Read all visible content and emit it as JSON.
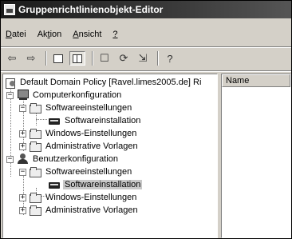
{
  "window": {
    "title": "Gruppenrichtlinienobjekt-Editor"
  },
  "menu": {
    "items": [
      {
        "label": "Datei",
        "mnemonic_index": 0
      },
      {
        "label": "Aktion",
        "mnemonic_index": 2
      },
      {
        "label": "Ansicht",
        "mnemonic_index": 0
      },
      {
        "label": "?",
        "mnemonic_index": 0
      }
    ]
  },
  "toolbar": {
    "buttons": [
      {
        "name": "back-button",
        "glyph": "⇦"
      },
      {
        "name": "forward-button",
        "glyph": "⇨"
      },
      {
        "name": "up-folder-button",
        "glyph": "⌂"
      },
      {
        "name": "show-hide-tree-button",
        "glyph": ""
      },
      {
        "name": "properties-button",
        "glyph": "☐"
      },
      {
        "name": "refresh-button",
        "glyph": "⟳"
      },
      {
        "name": "export-list-button",
        "glyph": "⇲"
      },
      {
        "name": "help-button",
        "glyph": "?"
      }
    ]
  },
  "tree": {
    "root": "Default Domain Policy [Ravel.limes2005.de] Ri",
    "nodes": [
      {
        "label": "Computerkonfiguration",
        "expander": "−"
      },
      {
        "label": "Softwareeinstellungen",
        "expander": "−"
      },
      {
        "label": "Softwareinstallation",
        "expander": ""
      },
      {
        "label": "Windows-Einstellungen",
        "expander": "+"
      },
      {
        "label": "Administrative Vorlagen",
        "expander": "+"
      },
      {
        "label": "Benutzerkonfiguration",
        "expander": "−"
      },
      {
        "label": "Softwareeinstellungen",
        "expander": "−"
      },
      {
        "label": "Softwareinstallation",
        "expander": ""
      },
      {
        "label": "Windows-Einstellungen",
        "expander": "+"
      },
      {
        "label": "Administrative Vorlagen",
        "expander": "+"
      }
    ]
  },
  "list": {
    "columns": [
      "Name"
    ]
  }
}
